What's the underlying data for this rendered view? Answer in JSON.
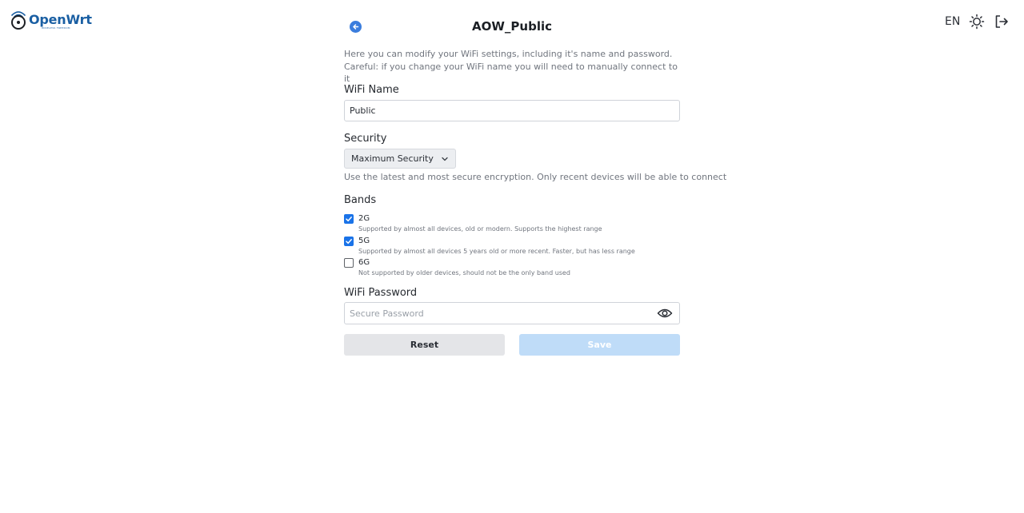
{
  "brand": {
    "name": "OpenWrt",
    "tagline": "WIRELESS FREEDOM"
  },
  "header": {
    "title": "AOW_Public",
    "language": "EN",
    "icons": {
      "back": "arrow-left-circle-icon",
      "theme": "sun-icon",
      "logout": "logout-icon"
    }
  },
  "form": {
    "intro": "Here you can modify your WiFi settings, including it's name and password. Careful: if you change your WiFi name you will need to manually connect to it",
    "wifi_name": {
      "label": "WiFi Name",
      "value": "Public"
    },
    "security": {
      "label": "Security",
      "selected": "Maximum Security",
      "description": "Use the latest and most secure encryption. Only recent devices will be able to connect"
    },
    "bands": {
      "label": "Bands",
      "items": [
        {
          "name": "2G",
          "checked": true,
          "description": "Supported by almost all devices, old or modern. Supports the highest range"
        },
        {
          "name": "5G",
          "checked": true,
          "description": "Supported by almost all devices 5 years old or more recent. Faster, but has less range"
        },
        {
          "name": "6G",
          "checked": false,
          "description": "Not supported by older devices, should not be the only band used"
        }
      ]
    },
    "password": {
      "label": "WiFi Password",
      "placeholder": "Secure Password",
      "value": ""
    },
    "buttons": {
      "reset": "Reset",
      "save": "Save"
    }
  },
  "colors": {
    "accent": "#1a73e8",
    "brand": "#1a5fa3",
    "save_disabled": "#bfdcf8"
  }
}
